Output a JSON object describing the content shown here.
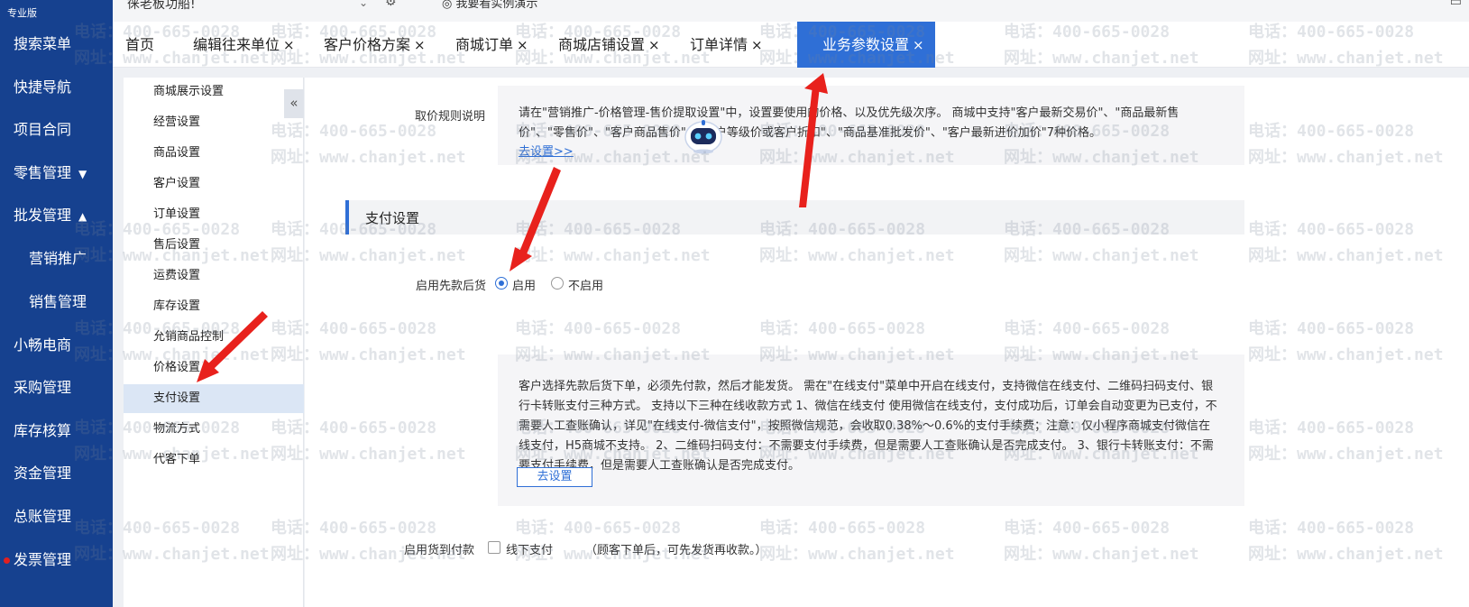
{
  "edition": "专业版",
  "account": "徕老板功船!",
  "demo_link": "我要看实例演示",
  "nav": [
    {
      "label": "搜索菜单",
      "caret": ""
    },
    {
      "label": "快捷导航",
      "caret": ""
    },
    {
      "label": "项目合同",
      "caret": ""
    },
    {
      "label": "零售管理",
      "caret": "▼"
    },
    {
      "label": "批发管理",
      "caret": "▲"
    },
    {
      "label": "营销推广",
      "caret": ""
    },
    {
      "label": "销售管理",
      "caret": ""
    },
    {
      "label": "小畅电商",
      "caret": ""
    },
    {
      "label": "采购管理",
      "caret": ""
    },
    {
      "label": "库存核算",
      "caret": ""
    },
    {
      "label": "资金管理",
      "caret": ""
    },
    {
      "label": "总账管理",
      "caret": ""
    },
    {
      "label": "发票管理",
      "caret": ""
    }
  ],
  "tabs": [
    {
      "label": "首页",
      "closable": false
    },
    {
      "label": "编辑往来单位",
      "closable": true
    },
    {
      "label": "客户价格方案",
      "closable": true
    },
    {
      "label": "商城订单",
      "closable": true
    },
    {
      "label": "商城店铺设置",
      "closable": true
    },
    {
      "label": "订单详情",
      "closable": true
    },
    {
      "label": "业务参数设置",
      "closable": true,
      "active": true
    }
  ],
  "tab_close_glyph": "×",
  "subnav": [
    "商城展示设置",
    "经营设置",
    "商品设置",
    "客户设置",
    "订单设置",
    "售后设置",
    "运费设置",
    "库存设置",
    "允销商品控制",
    "价格设置",
    "支付设置",
    "物流方式",
    "代客下单"
  ],
  "subnav_active": "支付设置",
  "collapse_glyph": "«",
  "price_rule": {
    "label": "取价规则说明",
    "text": "请在\"营销推广-价格管理-售价提取设置\"中，设置要使用的价格、以及优先级次序。 商城中支持\"客户最新交易价\"、\"商品最新售价\"、\"零售价\"、\"客户商品售价\"、\"客户等级价或客户折扣\"、\"商品基准批发价\"、\"客户最新进价加价\"7种价格。",
    "link": "去设置>>"
  },
  "section_title": "支付设置",
  "prepay": {
    "label": "启用先款后货",
    "options": [
      "启用",
      "不启用"
    ],
    "selected": "启用"
  },
  "prepay_info": "客户选择先款后货下单，必须先付款，然后才能发货。 需在\"在线支付\"菜单中开启在线支付，支持微信在线支付、二维码扫码支付、银行卡转账支付三种方式。 支持以下三种在线收款方式 1、微信在线支付 使用微信在线支付，支付成功后，订单会自动变更为已支付，不需要人工查账确认，详见\"在线支付-微信支付\"，按照微信规范，会收取0.38%～0.6%的支付手续费；注意：仅小程序商城支付微信在线支付，H5商城不支持。 2、二维码扫码支付：不需要支付手续费，但是需要人工查账确认是否完成支付。 3、银行卡转账支付：不需要支付手续费，但是需要人工查账确认是否完成支付。",
  "goto_settings_button": "去设置",
  "cod": {
    "label": "启用货到付款",
    "checkbox_label": "线下支付",
    "checked": false,
    "hint": "（顾客下单后，可先发货再收款。）"
  },
  "watermark": {
    "phone": "电话：400-665-0028",
    "site": "网址：www.chanjet.net"
  },
  "colors": {
    "nav_bg": "#16418f",
    "accent": "#2f6fd6",
    "arrow": "#e8211c"
  },
  "icons": {
    "account_caret": "chevron-down-icon",
    "settings": "gear-icon",
    "demo": "eye-icon",
    "corner": "message-icon",
    "assistant": "robot-assistant-icon"
  }
}
